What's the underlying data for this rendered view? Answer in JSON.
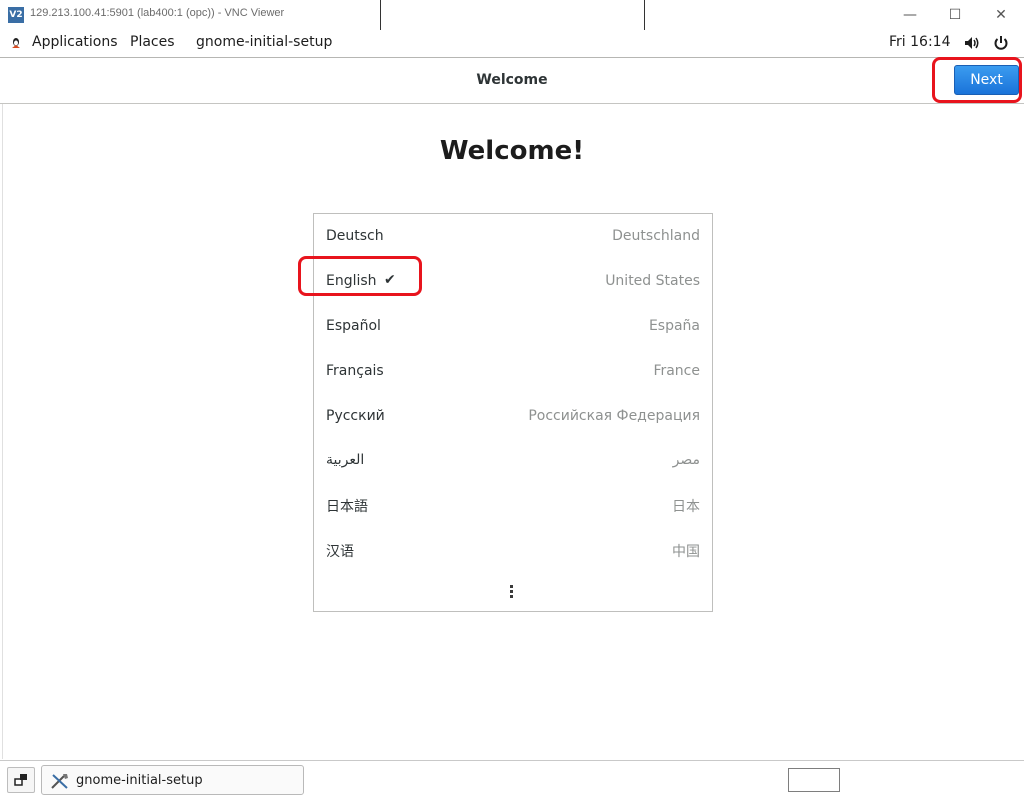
{
  "vnc": {
    "title": "129.213.100.41:5901 (lab400:1 (opc)) - VNC Viewer",
    "logo": "V2"
  },
  "panel": {
    "applications": "Applications",
    "places": "Places",
    "app_name": "gnome-initial-setup",
    "clock": "Fri 16:14"
  },
  "header": {
    "title": "Welcome",
    "next_label": "Next"
  },
  "main": {
    "heading": "Welcome!",
    "languages": [
      {
        "name": "Deutsch",
        "country": "Deutschland",
        "selected": false
      },
      {
        "name": "English",
        "country": "United States",
        "selected": true
      },
      {
        "name": "Español",
        "country": "España",
        "selected": false
      },
      {
        "name": "Français",
        "country": "France",
        "selected": false
      },
      {
        "name": "Русский",
        "country": "Российская Федерация",
        "selected": false
      },
      {
        "name": "العربية",
        "country": "مصر",
        "selected": false
      },
      {
        "name": "日本語",
        "country": "日本",
        "selected": false
      },
      {
        "name": "汉语",
        "country": "中国",
        "selected": false
      }
    ]
  },
  "taskbar": {
    "task_label": "gnome-initial-setup"
  },
  "colors": {
    "accent": "#1a73d9",
    "highlight": "#e8141d"
  }
}
